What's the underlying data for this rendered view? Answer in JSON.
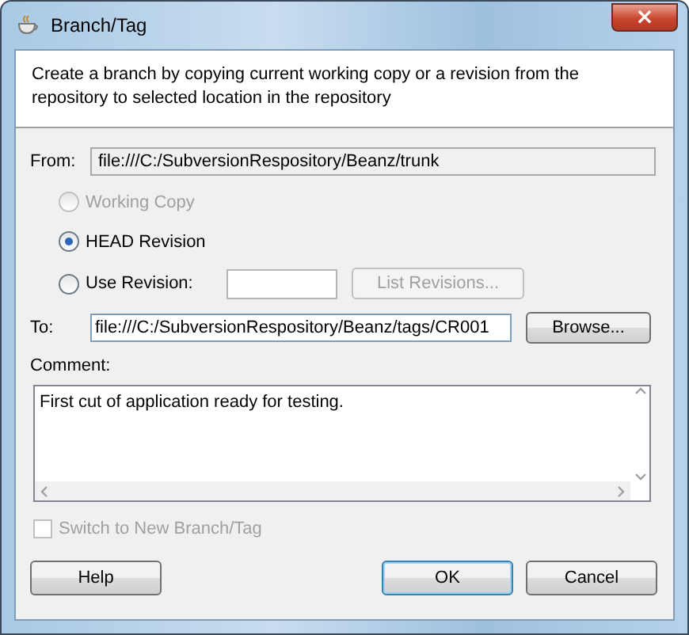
{
  "window": {
    "title": "Branch/Tag",
    "close": "×"
  },
  "description": "Create a branch by copying current working copy or a revision from the repository to selected location in the repository",
  "from": {
    "label": "From:",
    "value": "file:///C:/SubversionRespository/Beanz/trunk"
  },
  "source_options": [
    {
      "kind": "plain",
      "label": "Working Copy",
      "selected": false,
      "disabled": true
    },
    {
      "kind": "plain",
      "label": "HEAD Revision",
      "selected": true,
      "disabled": false
    },
    {
      "kind": "revision",
      "label": "Use Revision:",
      "selected": false,
      "disabled": false,
      "button": "List Revisions...",
      "button_disabled": true
    }
  ],
  "to": {
    "label": "To:",
    "value": "file:///C:/SubversionRespository/Beanz/tags/CR001",
    "button": "Browse..."
  },
  "comment": {
    "label": "Comment:",
    "value": "First cut of application ready for testing."
  },
  "switch_checkbox": {
    "label": "Switch to New Branch/Tag",
    "checked": false,
    "disabled": true
  },
  "buttons": [
    {
      "label": "Help",
      "kind": "left",
      "default": false
    },
    {
      "label": "OK",
      "kind": "right",
      "default": true
    },
    {
      "label": "Cancel",
      "kind": "right",
      "default": false
    }
  ]
}
